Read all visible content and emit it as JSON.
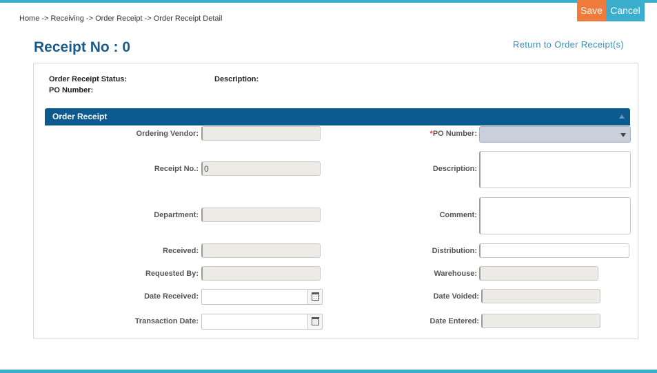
{
  "toolbar": {
    "save_label": "Save",
    "cancel_label": "Cancel"
  },
  "breadcrumb": [
    "Home",
    "Receiving",
    "Order Receipt",
    "Order Receipt Detail"
  ],
  "breadcrumb_sep": " -> ",
  "page": {
    "title": "Receipt No : 0",
    "return_link": "Return to Order Receipt(s)"
  },
  "summary": {
    "status_label": "Order Receipt Status:",
    "description_label": "Description:",
    "po_number_label": "PO Number:"
  },
  "section": {
    "title": "Order Receipt"
  },
  "form": {
    "ordering_vendor": {
      "label": "Ordering Vendor",
      "value": ""
    },
    "receipt_no": {
      "label": "Receipt No.",
      "value": "0"
    },
    "department": {
      "label": "Department",
      "value": ""
    },
    "received": {
      "label": "Received",
      "value": ""
    },
    "requested_by": {
      "label": "Requested By",
      "value": ""
    },
    "date_received": {
      "label": "Date Received",
      "value": ""
    },
    "transaction_date": {
      "label": "Transaction Date",
      "value": ""
    },
    "po_number": {
      "required_mark": "*",
      "label": "PO Number",
      "value": ""
    },
    "description": {
      "label": "Description",
      "value": ""
    },
    "comment": {
      "label": "Comment",
      "value": ""
    },
    "distribution": {
      "label": "Distribution",
      "value": ""
    },
    "warehouse": {
      "label": "Warehouse",
      "value": ""
    },
    "date_voided": {
      "label": "Date Voided",
      "value": ""
    },
    "date_entered": {
      "label": "Date Entered",
      "value": ""
    }
  },
  "colors": {
    "accent": "#3aaecc",
    "save": "#ee7a3b",
    "header": "#0c5a8f",
    "title": "#1b5b8a"
  },
  "icons": {
    "calendar": "calendar-icon",
    "dropdown": "chevron-down-icon",
    "collapse": "chevron-up-icon"
  }
}
